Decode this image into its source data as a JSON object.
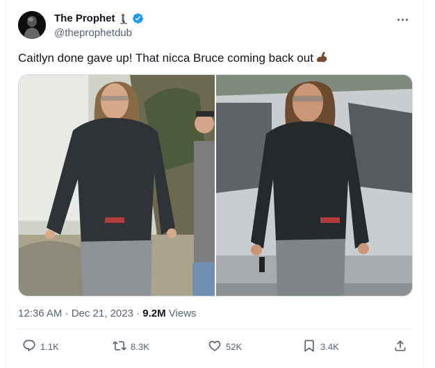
{
  "author": {
    "display_name": "The Prophet",
    "handle": "@theprophetdub",
    "avatar_icon": "avatar-silhouette",
    "badge_icon": "verified-badge-icon",
    "name_emoji": "praying-kneel-emoji"
  },
  "tweet": {
    "text": "Caitlyn done gave up! That nicca Bruce coming back out",
    "trailing_emoji": "flexed-biceps-emoji"
  },
  "meta": {
    "time_date": "12:36 AM · Dec 21, 2023 · ",
    "views_count": "9.2M",
    "views_label": " Views"
  },
  "actions": {
    "replies": "1.1K",
    "reposts": "8.3K",
    "likes": "52K",
    "bookmarks": "3.4K"
  },
  "colors": {
    "text": "#0f1419",
    "secondary": "#536471",
    "verified": "#1d9bf0",
    "border": "#cfd9de"
  }
}
